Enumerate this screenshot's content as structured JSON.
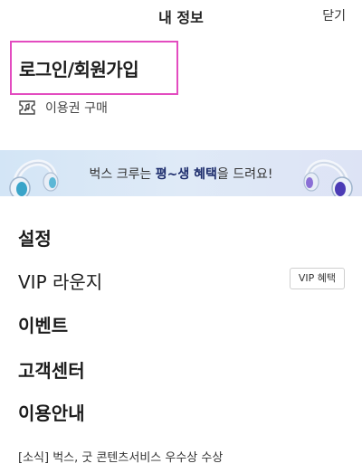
{
  "header": {
    "title": "내 정보",
    "close_label": "닫기"
  },
  "account": {
    "login_label": "로그인/회원가입",
    "ticket_label": "이용권 구매"
  },
  "banner": {
    "text_prefix": "벅스 크루는 ",
    "text_bold": "평~생 혜택",
    "text_suffix": "을 드려요!"
  },
  "menu": {
    "settings": "설정",
    "vip_lounge": "VIP 라운지",
    "vip_benefit": "VIP 혜택",
    "events": "이벤트",
    "customer_center": "고객센터",
    "guide": "이용안내"
  },
  "news": {
    "text": "[소식] 벅스, 굿 콘텐츠서비스 우수상 수상"
  }
}
